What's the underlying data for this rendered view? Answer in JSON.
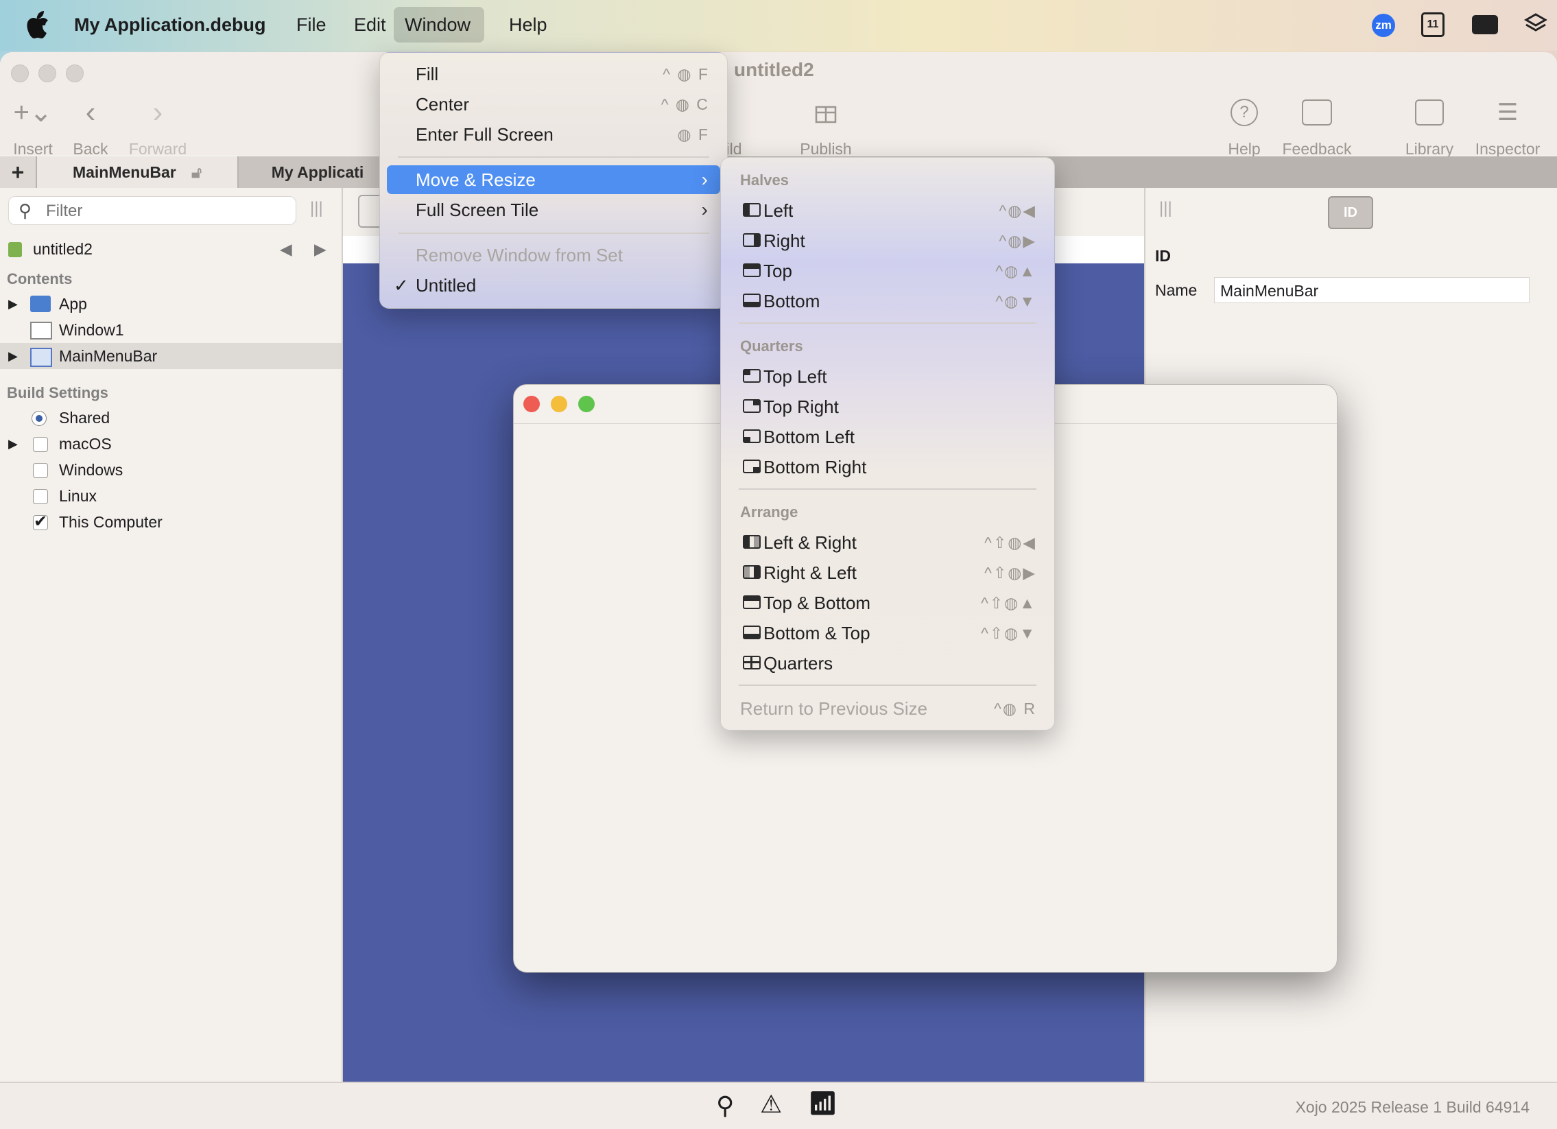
{
  "menubar": {
    "app_name": "My Application.debug",
    "items": [
      "File",
      "Edit",
      "Window",
      "Help"
    ]
  },
  "window": {
    "title": "untitled2",
    "toolbar": {
      "insert": "Insert",
      "back": "Back",
      "forward": "Forward",
      "build": "ild",
      "publish": "Publish",
      "help": "Help",
      "feedback": "Feedback",
      "library": "Library",
      "inspector": "Inspector"
    },
    "tabs": [
      "MainMenuBar",
      "My Applicati"
    ]
  },
  "navigator": {
    "filter_placeholder": "Filter",
    "project": "untitled2",
    "contents_header": "Contents",
    "contents": [
      "App",
      "Window1",
      "MainMenuBar"
    ],
    "build_header": "Build Settings",
    "build_items": [
      "Shared",
      "macOS",
      "Windows",
      "Linux",
      "This Computer"
    ]
  },
  "inspector": {
    "section": "ID",
    "name_label": "Name",
    "name_value": "MainMenuBar"
  },
  "window_menu": {
    "fill": {
      "label": "Fill",
      "shortcut": "^ ◍ F"
    },
    "center": {
      "label": "Center",
      "shortcut": "^ ◍ C"
    },
    "full_screen": {
      "label": "Enter Full Screen",
      "shortcut": "◍ F"
    },
    "move_resize": "Move & Resize",
    "full_screen_tile": "Full Screen Tile",
    "remove": "Remove Window from Set",
    "untitled": "Untitled",
    "checkmark": "✓"
  },
  "submenu": {
    "halves_header": "Halves",
    "halves": [
      {
        "label": "Left",
        "shortcut": "^◍◀"
      },
      {
        "label": "Right",
        "shortcut": "^◍▶"
      },
      {
        "label": "Top",
        "shortcut": "^◍▲"
      },
      {
        "label": "Bottom",
        "shortcut": "^◍▼"
      }
    ],
    "quarters_header": "Quarters",
    "quarters": [
      "Top Left",
      "Top Right",
      "Bottom Left",
      "Bottom Right"
    ],
    "arrange_header": "Arrange",
    "arrange": [
      {
        "label": "Left & Right",
        "shortcut": "^⇧◍◀"
      },
      {
        "label": "Right & Left",
        "shortcut": "^⇧◍▶"
      },
      {
        "label": "Top & Bottom",
        "shortcut": "^⇧◍▲"
      },
      {
        "label": "Bottom & Top",
        "shortcut": "^⇧◍▼"
      },
      {
        "label": "Quarters",
        "shortcut": ""
      }
    ],
    "return": {
      "label": "Return to Previous Size",
      "shortcut": "^◍ R"
    }
  },
  "status": {
    "version": "Xojo 2025 Release 1 Build 64914"
  },
  "colors": {
    "highlight": "#4f8ff2",
    "canvas": "#4d5ca3",
    "close": "#ee5c54",
    "minimize": "#f4bd3a",
    "zoom": "#5ec44b"
  }
}
